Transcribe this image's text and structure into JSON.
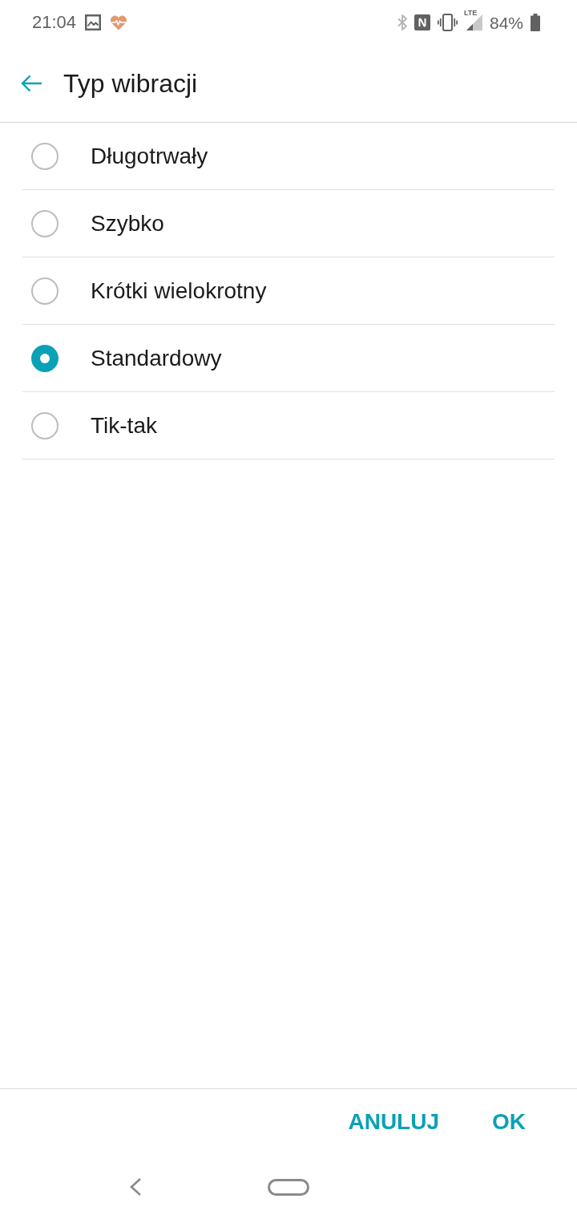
{
  "status_bar": {
    "time": "21:04",
    "network": "LTE",
    "battery": "84%"
  },
  "header": {
    "title": "Typ wibracji"
  },
  "options": [
    {
      "label": "Długotrwały",
      "selected": false
    },
    {
      "label": "Szybko",
      "selected": false
    },
    {
      "label": "Krótki wielokrotny",
      "selected": false
    },
    {
      "label": "Standardowy",
      "selected": true
    },
    {
      "label": "Tik-tak",
      "selected": false
    }
  ],
  "dialog_buttons": [
    "ANULUJ",
    "OK"
  ]
}
